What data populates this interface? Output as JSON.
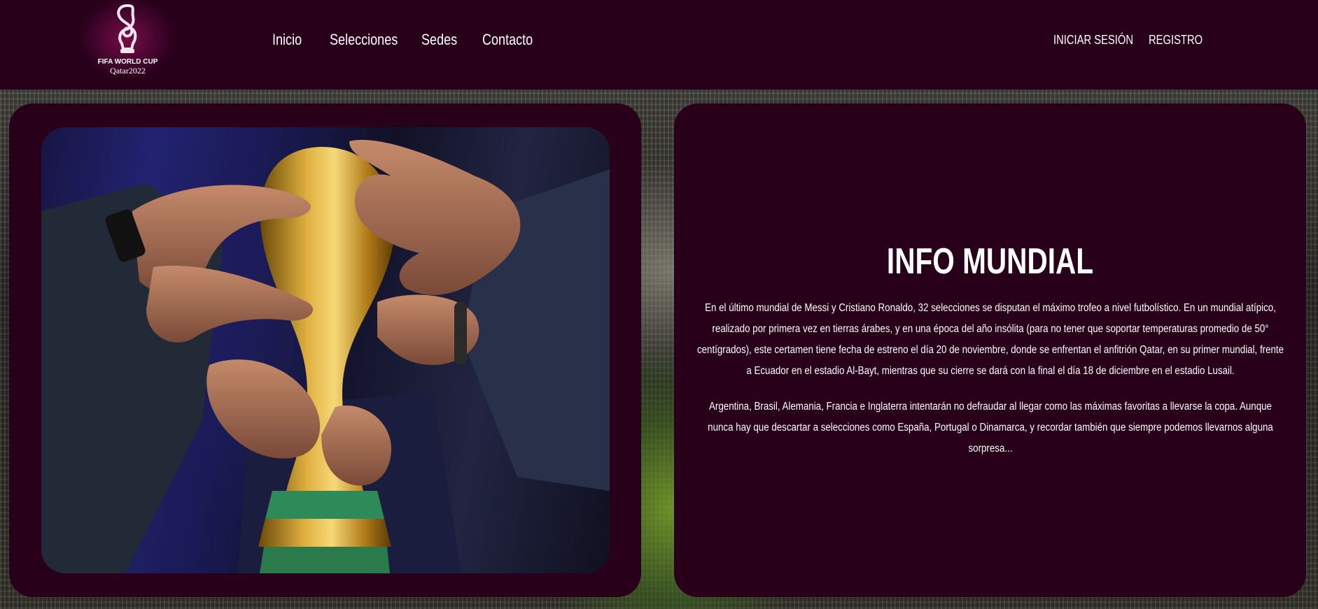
{
  "brand": {
    "line1": "FIFA WORLD CUP",
    "line2": "Qatar2022"
  },
  "nav": {
    "items": [
      {
        "label": "Inicio"
      },
      {
        "label": "Selecciones"
      },
      {
        "label": "Sedes"
      },
      {
        "label": "Contacto"
      }
    ]
  },
  "auth": {
    "login": "INICIAR SESIÓN",
    "register": "REGISTRO"
  },
  "info": {
    "title": "INFO MUNDIAL",
    "paragraph1": "En el último mundial de Messi y Cristiano Ronaldo, 32 selecciones se disputan el máximo trofeo a nivel futbolístico. En un mundial atípico, realizado por primera vez en tierras árabes, y en una época del año insólita (para no tener que soportar temperaturas promedio de 50° centígrados), este certamen tiene fecha de estreno el día 20 de noviembre, donde se enfrentan el anfitrión Qatar, en su primer mundial, frente a Ecuador en el estadio Al-Bayt, mientras que su cierre se dará con la final el día 18 de diciembre en el estadio Lusail.",
    "paragraph2": "Argentina, Brasil, Alemania, Francia e Inglaterra intentarán no defraudar al llegar como las máximas favoritas a llevarse la copa. Aunque nunca hay que descartar a selecciones como España, Portugal o Dinamarca, y recordar también que siempre podemos llevarnos alguna sorpresa..."
  },
  "colors": {
    "navbar": "#28001a",
    "card": "#28001a",
    "text": "#ffffff"
  },
  "images": {
    "hero": "trophy-hands-photo",
    "background": "stadium-photo"
  }
}
